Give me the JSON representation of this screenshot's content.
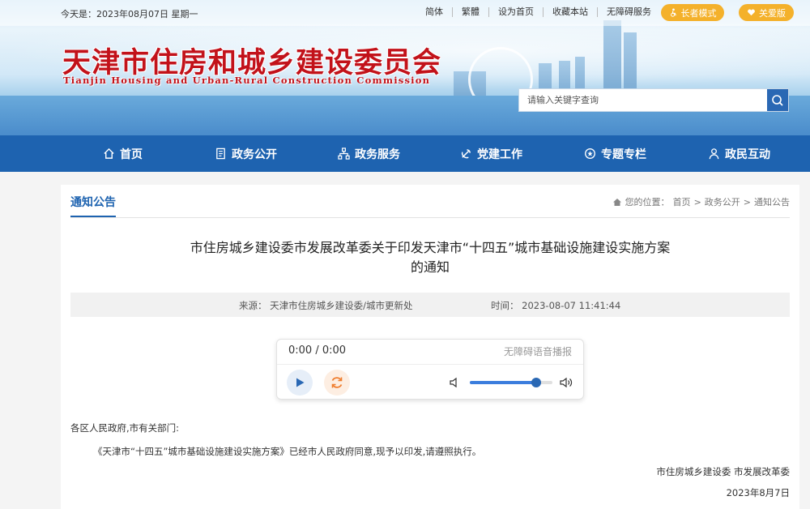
{
  "topbar": {
    "date_text": "今天是：2023年08月07日 星期一",
    "links": [
      "简体",
      "繁體",
      "设为首页",
      "收藏本站",
      "无障碍服务"
    ],
    "elder_mode": "长者模式",
    "care_mode": "关爱版"
  },
  "header": {
    "title": "天津市住房和城乡建设委员会",
    "subtitle": "Tianjin Housing and Urban-Rural Construction Commission"
  },
  "search": {
    "placeholder": "请输入关键字查询"
  },
  "nav": [
    {
      "label": "首页",
      "icon": "home-icon"
    },
    {
      "label": "政务公开",
      "icon": "document-icon"
    },
    {
      "label": "政务服务",
      "icon": "org-chart-icon"
    },
    {
      "label": "党建工作",
      "icon": "party-emblem-icon"
    },
    {
      "label": "专题专栏",
      "icon": "badge-icon"
    },
    {
      "label": "政民互动",
      "icon": "user-icon"
    }
  ],
  "section": {
    "tab": "通知公告",
    "breadcrumb_prefix": "您的位置：",
    "breadcrumb": [
      "首页",
      "政务公开",
      "通知公告"
    ],
    "breadcrumb_sep": ">"
  },
  "article": {
    "title_line1": "市住房城乡建设委市发展改革委关于印发天津市“十四五”城市基础设施建设实施方案",
    "title_line2": "的通知",
    "source_label": "来源：",
    "source": "天津市住房城乡建设委/城市更新处",
    "time_label": "时间：",
    "time": "2023-08-07 11:41:44",
    "salutation": "各区人民政府,市有关部门:",
    "paragraph": "《天津市“十四五”城市基础设施建设实施方案》已经市人民政府同意,现予以印发,请遵照执行。",
    "signature": "市住房城乡建设委  市发展改革委",
    "sign_date": "2023年8月7日"
  },
  "player": {
    "time": "0:00 / 0:00",
    "label": "无障碍语音播报",
    "volume": 0.8
  },
  "colors": {
    "primary": "#1e63b0",
    "title_red": "#c2121a",
    "accent_orange": "#f4b12b"
  }
}
